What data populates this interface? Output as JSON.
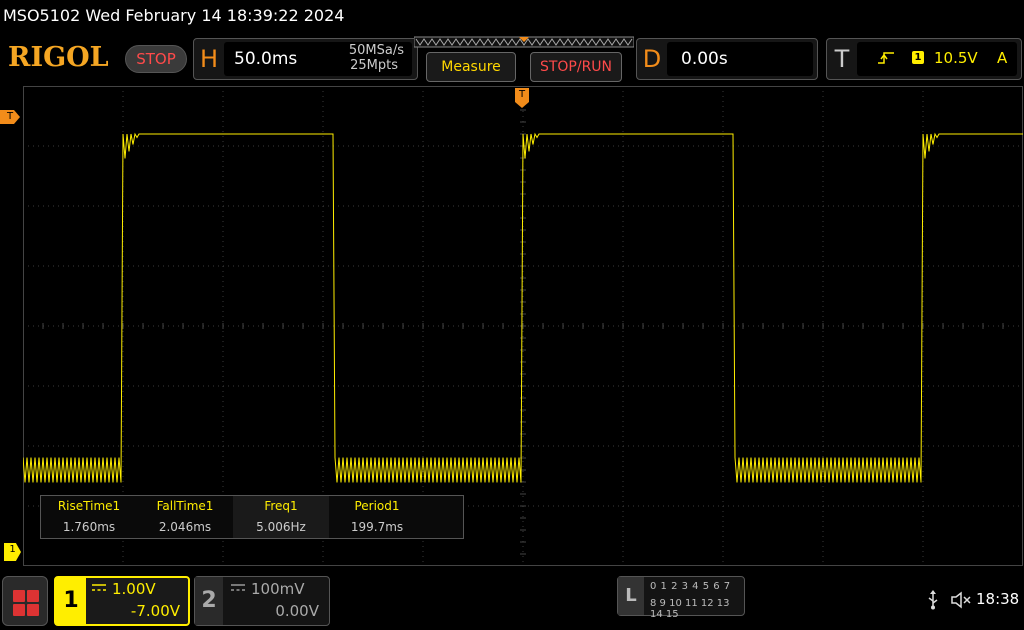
{
  "titlebar": {
    "text": "MSO5102  Wed February 14 18:39:22 2024"
  },
  "brand": {
    "logo": "RIGOL",
    "status_label": "STOP"
  },
  "horizontal": {
    "letter": "H",
    "timebase": "50.0ms",
    "sample_rate": "50MSa/s",
    "memory_depth": "25Mpts"
  },
  "buttons": {
    "measure": "Measure",
    "stop_run": "STOP/RUN"
  },
  "delay": {
    "letter": "D",
    "value": "0.00s"
  },
  "trigger": {
    "letter": "T",
    "source_channel": "1",
    "level": "10.5V",
    "mode": "A",
    "edge_icon": "rising-edge-icon"
  },
  "markers": {
    "trigger_left": "T",
    "trigger_top": "T",
    "channel1": "1"
  },
  "measurements": [
    {
      "name": "RiseTime1",
      "value": "1.760ms"
    },
    {
      "name": "FallTime1",
      "value": "2.046ms"
    },
    {
      "name": "Freq1",
      "value": "5.006Hz"
    },
    {
      "name": "Period1",
      "value": "199.7ms"
    }
  ],
  "channel1": {
    "number": "1",
    "scale": "1.00V",
    "offset": "-7.00V",
    "color": "#ffee00"
  },
  "channel2": {
    "number": "2",
    "scale": "100mV",
    "offset": "0.00V"
  },
  "logic_analyzer": {
    "letter": "L",
    "row1": "0 1 2 3  4 5 6 7",
    "row2": "8 9 10 11 12 13 14 15"
  },
  "status": {
    "time": "18:38"
  },
  "waveform": {
    "vertical_divisions": 8,
    "horizontal_divisions": 10,
    "high_level_div": 7.3,
    "low_level_div": 1.6,
    "period_div": 4.0,
    "duty": 0.53,
    "trace_color": "#ffee00"
  }
}
